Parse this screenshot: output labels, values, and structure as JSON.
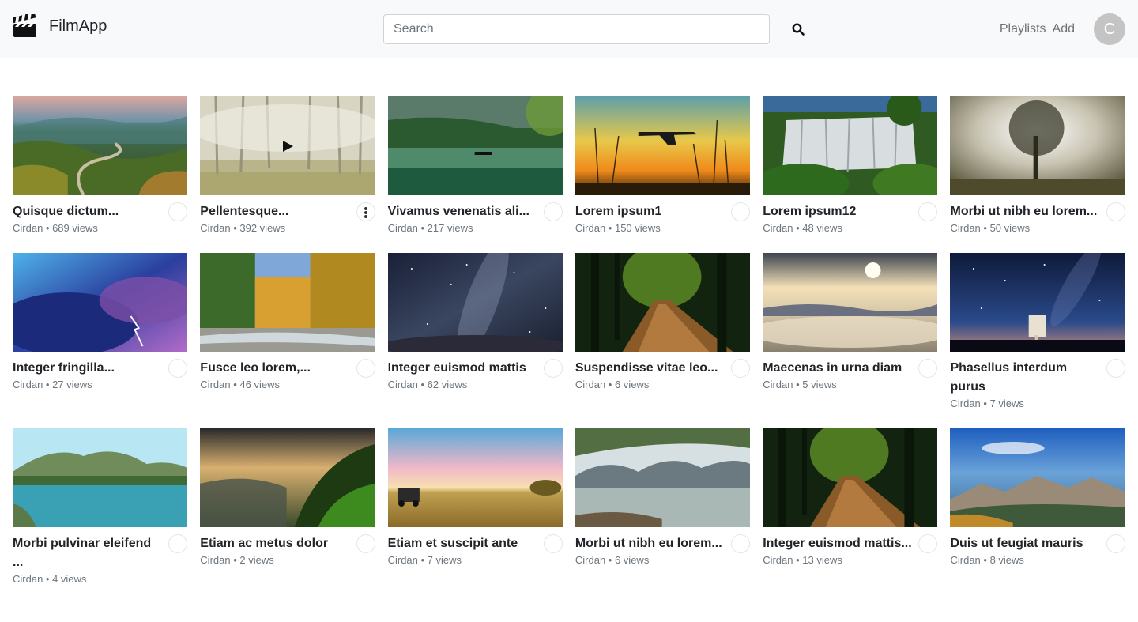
{
  "app": {
    "name": "FilmApp"
  },
  "search": {
    "placeholder": "Search"
  },
  "nav": {
    "playlists_label": "Playlists",
    "add_label": "Add",
    "avatar_initial": "C"
  },
  "videos": [
    {
      "title": "Quisque dictum...",
      "author": "Cirdan",
      "views": "689 views",
      "scene": "canyon"
    },
    {
      "title": "Pellentesque...",
      "author": "Cirdan",
      "views": "392 views",
      "scene": "forest-mist"
    },
    {
      "title": "Vivamus venenatis ali...",
      "author": "Cirdan",
      "views": "217 views",
      "scene": "lake-boat"
    },
    {
      "title": "Lorem ipsum1",
      "author": "Cirdan",
      "views": "150 views",
      "scene": "sunset-plane"
    },
    {
      "title": "Lorem ipsum12",
      "author": "Cirdan",
      "views": "48 views",
      "scene": "waterfall"
    },
    {
      "title": "Morbi ut nibh eu lorem...",
      "author": "Cirdan",
      "views": "50 views",
      "scene": "tree-fog"
    },
    {
      "title": "Integer fringilla...",
      "author": "Cirdan",
      "views": "27 views",
      "scene": "storm"
    },
    {
      "title": "Fusce leo lorem,...",
      "author": "Cirdan",
      "views": "46 views",
      "scene": "autumn-river"
    },
    {
      "title": "Integer euismod mattis",
      "author": "Cirdan",
      "views": "62 views",
      "scene": "milky-way"
    },
    {
      "title": "Suspendisse vitae leo...",
      "author": "Cirdan",
      "views": "6 views",
      "scene": "forest-path"
    },
    {
      "title": "Maecenas in urna diam",
      "author": "Cirdan",
      "views": "5 views",
      "scene": "cloud-sea"
    },
    {
      "title": "Phasellus interdum purus",
      "author": "Cirdan",
      "views": "7 views",
      "scene": "night-tower"
    },
    {
      "title": "Morbi pulvinar eleifend ...",
      "author": "Cirdan",
      "views": "4 views",
      "scene": "mountain-lake"
    },
    {
      "title": "Etiam ac metus dolor",
      "author": "Cirdan",
      "views": "2 views",
      "scene": "misty-hills"
    },
    {
      "title": "Etiam et suscipit ante",
      "author": "Cirdan",
      "views": "7 views",
      "scene": "field-car"
    },
    {
      "title": "Morbi ut nibh eu lorem...",
      "author": "Cirdan",
      "views": "6 views",
      "scene": "alpine-lake"
    },
    {
      "title": "Integer euismod mattis...",
      "author": "Cirdan",
      "views": "13 views",
      "scene": "forest-path"
    },
    {
      "title": "Duis ut feugiat mauris",
      "author": "Cirdan",
      "views": "8 views",
      "scene": "alps"
    }
  ],
  "hovered_index": 1
}
